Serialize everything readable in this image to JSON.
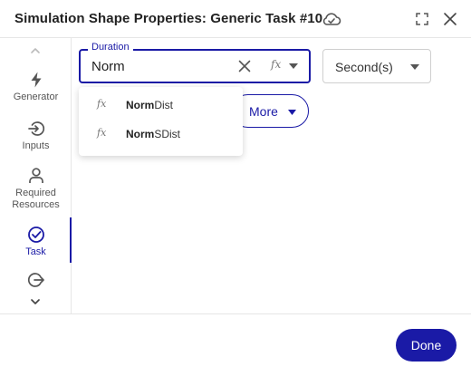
{
  "dialog": {
    "title": "Simulation Shape Properties: Generic Task #10"
  },
  "icons": {
    "cloud": "cloud-sync-icon",
    "expand": "expand-icon",
    "close": "close-icon"
  },
  "sidebar": {
    "items": [
      {
        "label": "Generator",
        "icon": "bolt-icon"
      },
      {
        "label": "Inputs",
        "icon": "arrow-in-icon"
      },
      {
        "label": "Required\nResources",
        "icon": "person-icon"
      },
      {
        "label": "Task",
        "icon": "check-circle-icon",
        "active": true
      },
      {
        "label": "",
        "icon": "arrow-out-icon"
      }
    ]
  },
  "duration": {
    "label": "Duration",
    "value": "Norm",
    "fx_symbol": "fx"
  },
  "unit": {
    "selected": "Second(s)"
  },
  "more": {
    "label": "More"
  },
  "suggestions": [
    {
      "match": "Norm",
      "rest": "Dist",
      "fx": "fx"
    },
    {
      "match": "Norm",
      "rest": "SDist",
      "fx": "fx"
    }
  ],
  "footer": {
    "done_label": "Done"
  },
  "colors": {
    "accent": "#1a1aa6"
  }
}
